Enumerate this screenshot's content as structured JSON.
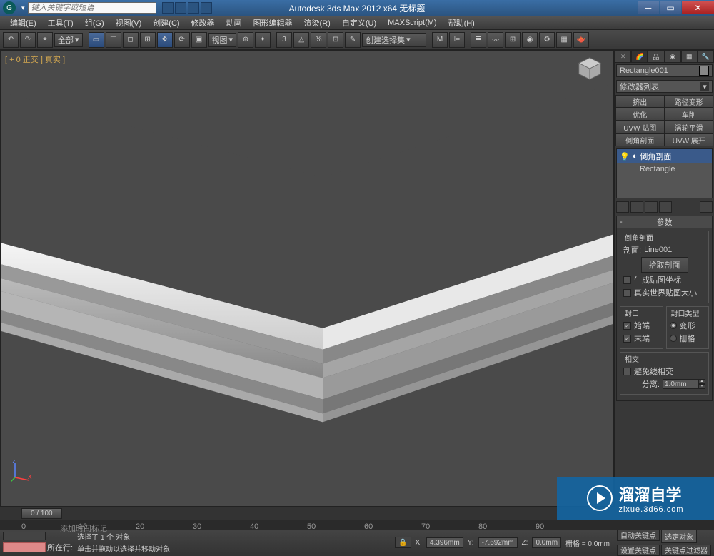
{
  "title": "Autodesk 3ds Max  2012  x64    无标题",
  "search_placeholder": "键入关键字或短语",
  "menu": [
    "编辑(E)",
    "工具(T)",
    "组(G)",
    "视图(V)",
    "创建(C)",
    "修改器",
    "动画",
    "图形编辑器",
    "渲染(R)",
    "自定义(U)",
    "MAXScript(M)",
    "帮助(H)"
  ],
  "toolbar": {
    "dropdown1": "全部",
    "dropdown2": "视图",
    "dropdown3": "创建选择集"
  },
  "viewport": {
    "label": "[ + 0 正交 ] 真实 ]"
  },
  "panel": {
    "object_name": "Rectangle001",
    "modlist": "修改器列表",
    "buttons": [
      "挤出",
      "路径变形",
      "优化",
      "车削",
      "UVW 贴图",
      "涡轮平滑",
      "倒角剖面",
      "UVW 展开"
    ],
    "stack": [
      {
        "icon": "◐",
        "label": "倒角剖面",
        "sel": true
      },
      {
        "icon": "",
        "label": "Rectangle",
        "sel": false
      }
    ],
    "rollout": {
      "title": "参数",
      "section1": {
        "title": "倒角剖面",
        "profile_label": "剖面:",
        "profile_value": "Line001",
        "pick_btn": "拾取剖面",
        "gen_mapping": "生成贴图坐标",
        "real_world": "真实世界贴图大小"
      },
      "cap": {
        "title": "封口",
        "start": "始端",
        "end": "末端"
      },
      "captype": {
        "title": "封口类型",
        "morph": "变形",
        "grid": "栅格"
      },
      "intersect": {
        "title": "相交",
        "avoid": "避免线相交",
        "sep_label": "分离:",
        "sep_value": "1.0mm"
      }
    }
  },
  "timeline": {
    "slider": "0 / 100"
  },
  "status": {
    "sel_info": "选择了 1 个 对象",
    "hint": "单击并拖动以选择并移动对象",
    "x_label": "X:",
    "x_val": "4.396mm",
    "y_label": "Y:",
    "y_val": "-7.692mm",
    "z_label": "Z:",
    "z_val": "0.0mm",
    "grid": "栅格 = 0.0mm",
    "autokey": "自动关键点",
    "selset": "选定对象",
    "setkey": "设置关键点",
    "keyfilter": "关键点过滤器",
    "addtime": "添加时间标记",
    "row_label": "所在行:"
  },
  "watermark": {
    "big": "溜溜自学",
    "small": "zixue.3d66.com"
  }
}
